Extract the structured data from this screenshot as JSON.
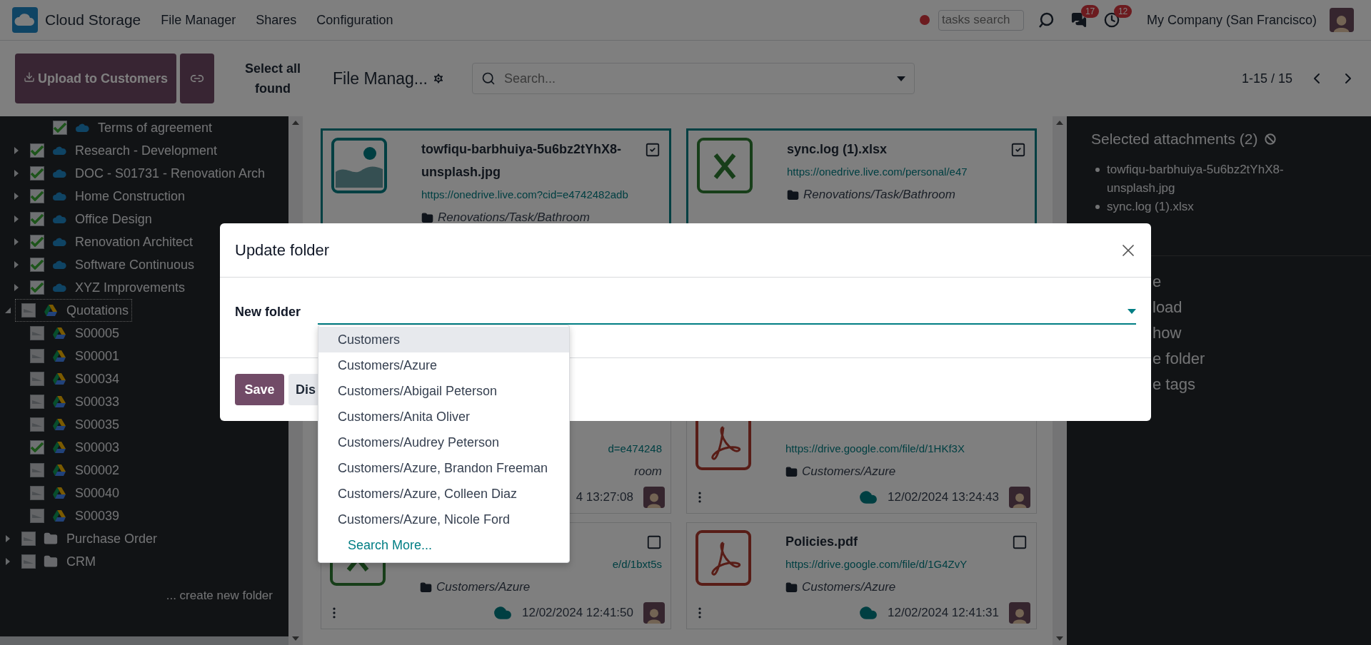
{
  "navbar": {
    "app_name": "Cloud Storage",
    "menu": [
      "File Manager",
      "Shares",
      "Configuration"
    ],
    "tasks_search": {
      "placeholder": "tasks search"
    },
    "messages_badge": "17",
    "activities_badge": "12",
    "company": "My Company (San Francisco)"
  },
  "control_panel": {
    "upload_button": "Upload to Customers",
    "select_all_button": "Select all found",
    "breadcrumb": "File Manag...",
    "search": {
      "placeholder": "Search..."
    },
    "pager": "1-15 / 15"
  },
  "sidebar": {
    "tree": [
      {
        "children": [
          {
            "children": [
              {
                "label": "Terms of agreement",
                "kind": "onedrive",
                "checked": true
              }
            ]
          },
          {
            "label": "Research - Development",
            "kind": "onedrive",
            "checked": true,
            "expanded": false
          },
          {
            "label": "DOC - S01731 - Renovation Arch",
            "kind": "onedrive",
            "checked": true,
            "expanded": false
          },
          {
            "label": "Home Construction",
            "kind": "onedrive",
            "checked": true,
            "expanded": false
          },
          {
            "label": "Office Design",
            "kind": "onedrive",
            "checked": true,
            "expanded": false
          },
          {
            "label": "Renovation Architect",
            "kind": "onedrive",
            "checked": true,
            "expanded": false
          },
          {
            "label": "Software Continuous",
            "kind": "onedrive",
            "checked": true,
            "expanded": false
          },
          {
            "label": "XYZ Improvements",
            "kind": "onedrive",
            "checked": true,
            "expanded": false
          }
        ]
      },
      {
        "label": "Quotations",
        "kind": "gdrive",
        "checked": false,
        "expanded": true,
        "focused": true,
        "children": [
          {
            "label": "S00005",
            "kind": "gdrive",
            "checked": false
          },
          {
            "label": "S00001",
            "kind": "gdrive",
            "checked": false
          },
          {
            "label": "S00034",
            "kind": "gdrive",
            "checked": false
          },
          {
            "label": "S00033",
            "kind": "gdrive",
            "checked": false
          },
          {
            "label": "S00035",
            "kind": "gdrive",
            "checked": false
          },
          {
            "label": "S00003",
            "kind": "gdrive",
            "checked": true
          },
          {
            "label": "S00002",
            "kind": "gdrive",
            "checked": false
          },
          {
            "label": "S00040",
            "kind": "gdrive",
            "checked": false
          },
          {
            "label": "S00039",
            "kind": "gdrive",
            "checked": false
          }
        ]
      },
      {
        "label": "Purchase Order",
        "kind": "folder",
        "checked": false,
        "expanded": false
      },
      {
        "label": "CRM",
        "kind": "folder",
        "checked": false,
        "expanded": false
      }
    ],
    "create_link": "... create new folder"
  },
  "cards": [
    {
      "kind": "image",
      "title": "towfiqu-barbhuiya-5u6bz2tYhX8-unsplash.jpg",
      "checked": true,
      "link": "https://onedrive.live.com?cid=e4742482adb",
      "folder": "Renovations/Task/Bathroom"
    },
    {
      "kind": "spreadsheet",
      "title": "sync.log (1).xlsx",
      "checked": true,
      "link": "https://onedrive.live.com/personal/e47",
      "folder": "Renovations/Task/Bathroom"
    },
    {
      "link_tail": "d=e474248",
      "folder_tail": "room",
      "date": "4 13:27:08"
    },
    {
      "kind": "pdf",
      "link": "https://drive.google.com/file/d/1HKf3X",
      "folder": "Customers/Azure",
      "cloud": true,
      "date": "12/02/2024 13:24:43"
    },
    {
      "kind": "spreadsheet",
      "checked": false,
      "link_tail": "e/d/1bxt5s",
      "folder": "Customers/Azure",
      "cloud": true,
      "date": "12/02/2024 12:41:50"
    },
    {
      "kind": "pdf",
      "title": "Policies.pdf",
      "checked": false,
      "link": "https://drive.google.com/file/d/1G4ZvY",
      "folder": "Customers/Azure",
      "cloud": true,
      "date": "12/02/2024 12:41:31"
    }
  ],
  "selection_panel": {
    "title": "Selected attachments (2)",
    "items": [
      "towfiqu-barbhuiya-5u6bz2tYhX8-unsplash.jpg",
      "sync.log (1).xlsx"
    ],
    "actions": [
      "e",
      "load",
      "how",
      "e folder",
      "e tags"
    ]
  },
  "dialog": {
    "title": "Update folder",
    "field_label": "New folder",
    "options": [
      {
        "label": "Customers",
        "selected": true
      },
      {
        "label": "Customers/Azure",
        "selected": false
      },
      {
        "label": "Customers/Abigail Peterson",
        "selected": false
      },
      {
        "label": "Customers/Anita Oliver",
        "selected": false
      },
      {
        "label": "Customers/Audrey Peterson",
        "selected": false
      },
      {
        "label": "Customers/Azure, Brandon Freeman",
        "selected": false
      },
      {
        "label": "Customers/Azure, Colleen Diaz",
        "selected": false
      },
      {
        "label": "Customers/Azure, Nicole Ford",
        "selected": false
      }
    ],
    "search_more": "Search More...",
    "save_button": "Save",
    "discard_button": "Dis"
  }
}
